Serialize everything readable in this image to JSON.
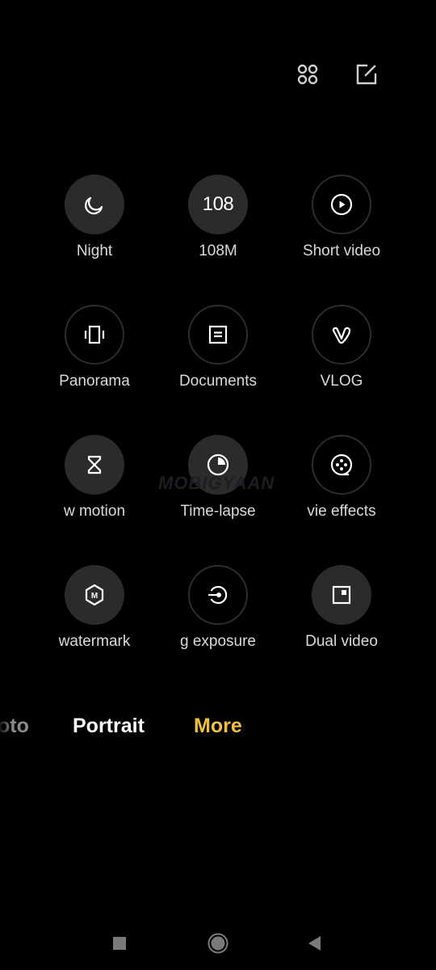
{
  "top_bar": {
    "grid_icon": "grid-four-dots-icon",
    "edit_icon": "edit-square-icon"
  },
  "modes": [
    {
      "label": "Night",
      "icon": "moon-icon",
      "style": "filled"
    },
    {
      "label": "108M",
      "icon_text": "108",
      "icon": "108-text-icon",
      "style": "filled"
    },
    {
      "label": "Short video",
      "icon": "play-circle-icon",
      "style": "outlined"
    },
    {
      "label": "Panorama",
      "icon": "panorama-icon",
      "style": "outlined"
    },
    {
      "label": "Documents",
      "icon": "document-icon",
      "style": "outlined"
    },
    {
      "label": "VLOG",
      "icon": "vlog-icon",
      "style": "outlined"
    },
    {
      "label": "w motion",
      "icon": "hourglass-icon",
      "style": "filled"
    },
    {
      "label": "Time-lapse",
      "icon": "timer-icon",
      "style": "filled"
    },
    {
      "label": "vie effects",
      "icon": "film-reel-icon",
      "style": "outlined"
    },
    {
      "label": "watermark",
      "icon": "m-hexagon-icon",
      "style": "filled"
    },
    {
      "label": "g exposure",
      "icon": "long-exposure-icon",
      "style": "outlined"
    },
    {
      "label": "Dual video",
      "icon": "dual-video-icon",
      "style": "filled"
    }
  ],
  "watermark_text": "MOBIGYAAN",
  "mode_tabs": [
    {
      "label": "oto",
      "state": "faded"
    },
    {
      "label": "Portrait",
      "state": "normal"
    },
    {
      "label": "More",
      "state": "active"
    }
  ],
  "colors": {
    "active_tab": "#f2c230",
    "normal_tab": "#ffffff",
    "faded_tab": "#8a8a8a",
    "circle_fill": "#2b2b2b",
    "circle_outline": "#2c2c2c"
  },
  "nav_bar": {
    "recents_icon": "square-icon",
    "home_icon": "circle-home-icon",
    "back_icon": "triangle-back-icon"
  }
}
